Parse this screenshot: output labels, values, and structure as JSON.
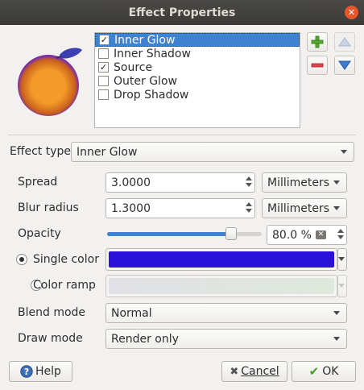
{
  "window": {
    "title": "Effect Properties"
  },
  "effects": [
    {
      "label": "Inner Glow",
      "checked": true,
      "selected": true
    },
    {
      "label": "Inner Shadow",
      "checked": false,
      "selected": false
    },
    {
      "label": "Source",
      "checked": true,
      "selected": false
    },
    {
      "label": "Outer Glow",
      "checked": false,
      "selected": false
    },
    {
      "label": "Drop Shadow",
      "checked": false,
      "selected": false
    }
  ],
  "form": {
    "effect_type_label": "Effect type",
    "effect_type_value": "Inner Glow",
    "spread_label": "Spread",
    "spread_value": "3.0000",
    "spread_unit": "Millimeters",
    "blur_label": "Blur radius",
    "blur_value": "1.3000",
    "blur_unit": "Millimeters",
    "opacity_label": "Opacity",
    "opacity_value": "80.0 %",
    "opacity_fraction": 0.8,
    "single_color_label": "Single color",
    "single_color": "#2a10d8",
    "color_ramp_label": "Color ramp",
    "blend_mode_label": "Blend mode",
    "blend_mode_value": "Normal",
    "draw_mode_label": "Draw mode",
    "draw_mode_value": "Render only"
  },
  "buttons": {
    "help": "Help",
    "cancel": "Cancel",
    "ok": "OK"
  },
  "colors": {
    "selection": "#3f82cf",
    "preview_fill": "#f39a28",
    "preview_glow": "#7a2fa8",
    "leaf": "#3b3fb0"
  },
  "icons": {
    "add": "plus-icon",
    "remove": "minus-icon",
    "up": "arrow-up-icon",
    "down": "arrow-down-icon"
  }
}
